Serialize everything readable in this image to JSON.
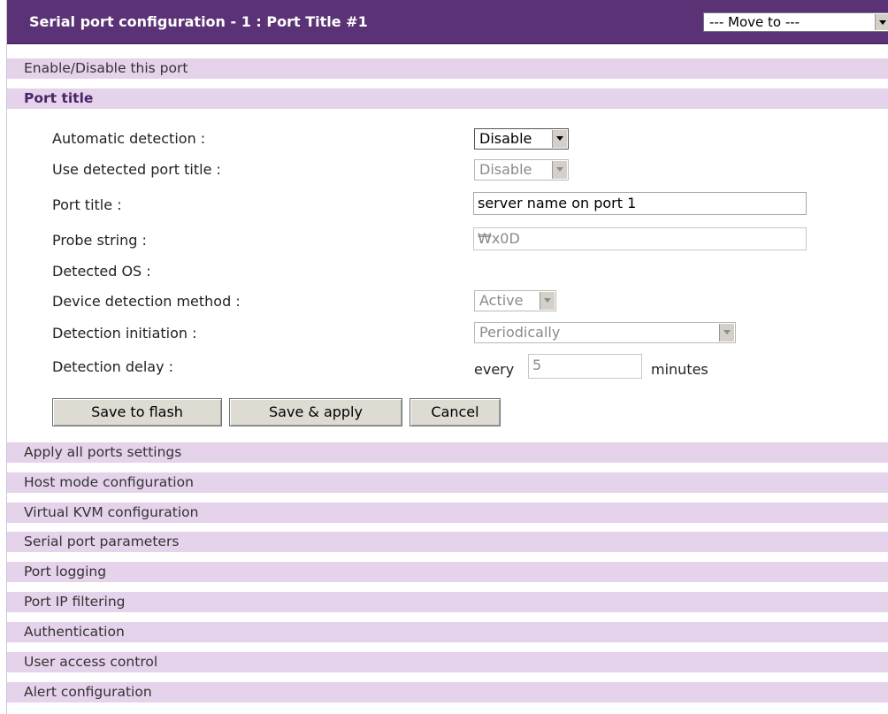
{
  "header": {
    "title": "Serial port configuration - 1 : Port Title #1",
    "move_to": "--- Move to ---"
  },
  "sections_top": [
    {
      "label": "Enable/Disable this port"
    },
    {
      "label": "Port title"
    }
  ],
  "form": {
    "automatic_detection": {
      "label": "Automatic detection :",
      "value": "Disable"
    },
    "use_detected_title": {
      "label": "Use detected port title :",
      "value": "Disable"
    },
    "port_title": {
      "label": "Port title :",
      "value": "server name on port 1"
    },
    "probe_string": {
      "label": "Probe string :",
      "value": "₩x0D"
    },
    "detected_os": {
      "label": "Detected OS :"
    },
    "detection_method": {
      "label": "Device detection method :",
      "value": "Active"
    },
    "detection_initiation": {
      "label": "Detection initiation :",
      "value": "Periodically"
    },
    "detection_delay": {
      "label": "Detection delay :",
      "prefix": "every",
      "value": "5",
      "suffix": "minutes"
    }
  },
  "buttons": {
    "save_flash": "Save to flash",
    "save_apply": "Save & apply",
    "cancel": "Cancel"
  },
  "sections_bottom": [
    {
      "label": "Apply all ports settings"
    },
    {
      "label": "Host mode configuration"
    },
    {
      "label": "Virtual KVM configuration"
    },
    {
      "label": "Serial port parameters"
    },
    {
      "label": "Port logging"
    },
    {
      "label": "Port IP filtering"
    },
    {
      "label": "Authentication"
    },
    {
      "label": "User access control"
    },
    {
      "label": "Alert configuration"
    }
  ],
  "colors": {
    "title_bar": "#5b3275",
    "section_bar": "#e5d3ec"
  }
}
